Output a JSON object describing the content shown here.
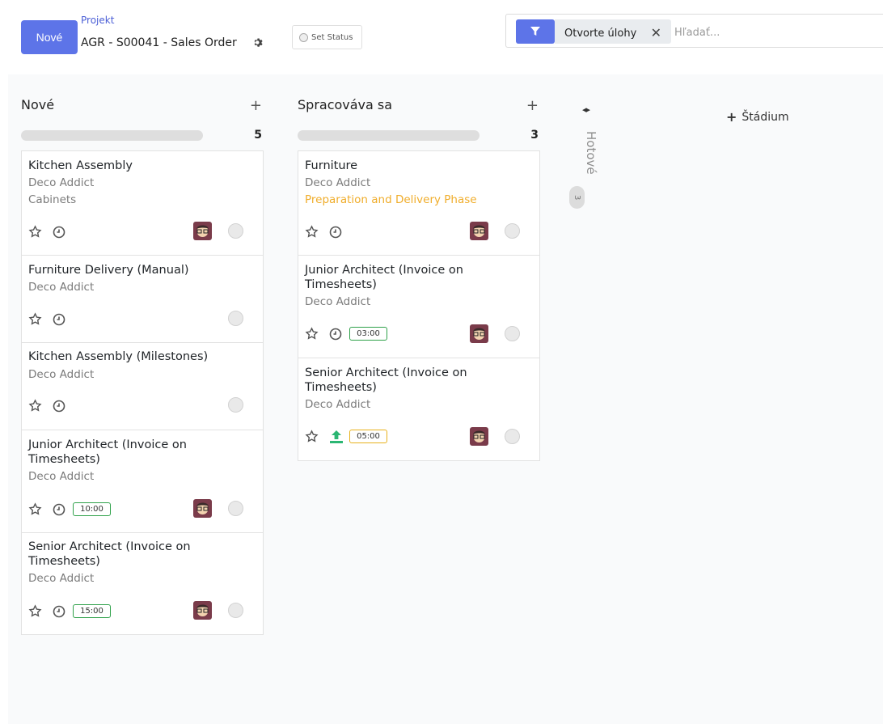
{
  "control": {
    "new_button": "Nové",
    "breadcrumb_label": "Projekt",
    "breadcrumb_title": "AGR - S00041 - Sales Order",
    "set_status": "Set Status",
    "facet_label": "Otvorte úlohy",
    "search_placeholder": "Hľadať..."
  },
  "columns": [
    {
      "title": "Nové",
      "count": "5",
      "cards": [
        {
          "title": "Kitchen Assembly",
          "customer": "Deco Addict",
          "tag": "Cabinets"
        },
        {
          "title": "Furniture Delivery (Manual)",
          "customer": "Deco Addict"
        },
        {
          "title": "Kitchen Assembly (Milestones)",
          "customer": "Deco Addict"
        },
        {
          "title": "Junior Architect (Invoice on Timesheets)",
          "customer": "Deco Addict",
          "hours": "10:00"
        },
        {
          "title": "Senior Architect (Invoice on Timesheets)",
          "customer": "Deco Addict",
          "hours": "15:00"
        }
      ]
    },
    {
      "title": "Spracováva sa",
      "count": "3",
      "cards": [
        {
          "title": "Furniture",
          "customer": "Deco Addict",
          "tag": "Preparation and Delivery Phase"
        },
        {
          "title": "Junior Architect (Invoice on Timesheets)",
          "customer": "Deco Addict",
          "hours": "03:00"
        },
        {
          "title": "Senior Architect (Invoice on Timesheets)",
          "customer": "Deco Addict",
          "hours": "05:00"
        }
      ]
    }
  ],
  "folded_column": {
    "title": "Hotové",
    "count": "3"
  },
  "add_stage_label": "Štádium",
  "colors": {
    "primary": "#5d74e8",
    "tag_orange": "#f0ad2b",
    "badge_green": "#2fa14a",
    "badge_yellow": "#e8b21d"
  }
}
